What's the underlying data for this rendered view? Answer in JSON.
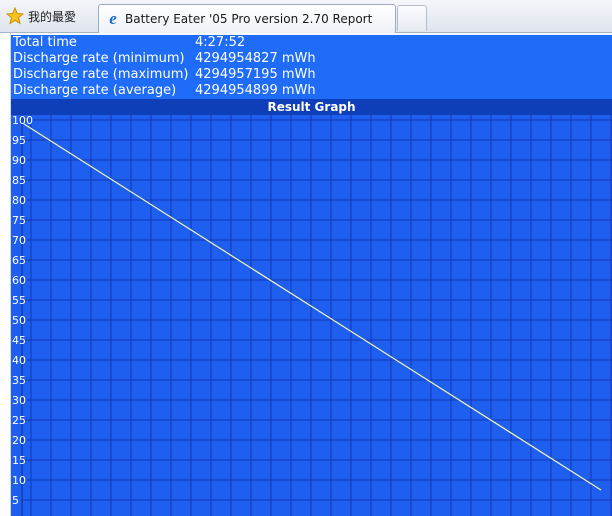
{
  "tabbar": {
    "favorites_label": "我的最愛",
    "active_tab_title": "Battery Eater '05 Pro version 2.70 Report",
    "favorites_icon": "star-icon",
    "tab_icon": "ie-icon"
  },
  "stats": [
    {
      "label": "Total time",
      "value": "4:27:52"
    },
    {
      "label": "Discharge rate (minimum)",
      "value": "4294954827 mWh"
    },
    {
      "label": "Discharge rate (maximum)",
      "value": "4294957195 mWh"
    },
    {
      "label": "Discharge rate (average)",
      "value": "4294954899 mWh"
    }
  ],
  "graph": {
    "title": "Result Graph"
  },
  "chart_data": {
    "type": "line",
    "title": "Result Graph",
    "xlabel": "",
    "ylabel": "",
    "ylim": [
      5,
      100
    ],
    "y_ticks": [
      100,
      95,
      90,
      85,
      80,
      75,
      70,
      65,
      60,
      55,
      50,
      45,
      40,
      35,
      30,
      25,
      20,
      15,
      10,
      5
    ],
    "grid": true,
    "series": [
      {
        "values": [
          99,
          7.5
        ]
      }
    ],
    "colors": {
      "background": "#1f5ff0",
      "grid": "#1237b4",
      "line": "#f2f6b0"
    }
  }
}
